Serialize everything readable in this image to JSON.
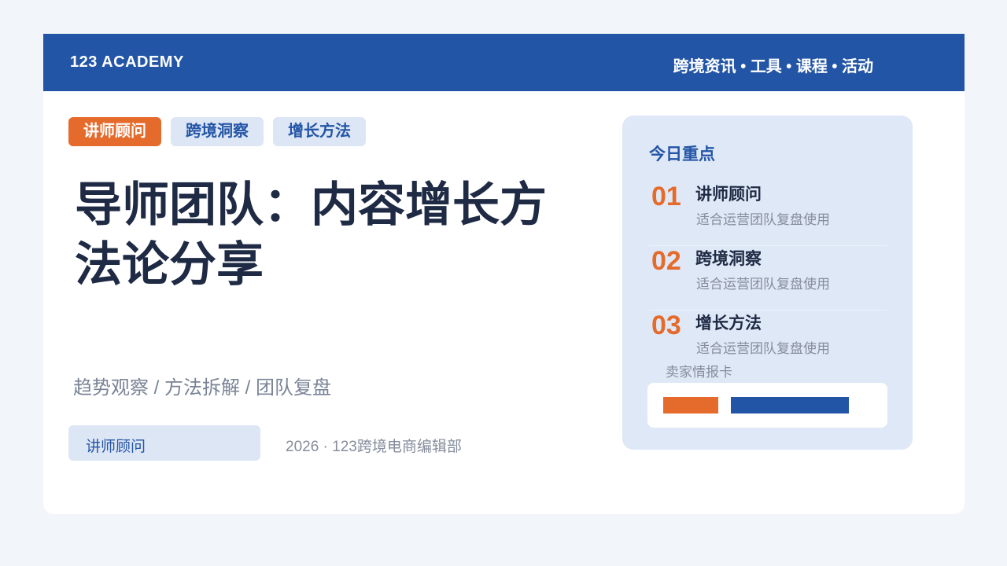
{
  "header": {
    "brand": "123 ACADEMY",
    "nav": "跨境资讯 • 工具 • 课程 • 活动"
  },
  "tags": [
    "讲师顾问",
    "跨境洞察",
    "增长方法"
  ],
  "title": "导师团队：内容增长方法论分享",
  "subtitle": "趋势观察 / 方法拆解 / 团队复盘",
  "author_label": "讲师顾问",
  "footer_meta": "2026 · 123跨境电商编辑部",
  "panel": {
    "title": "今日重点",
    "items": [
      {
        "num": "01",
        "title": "讲师顾问",
        "desc": "适合运营团队复盘使用"
      },
      {
        "num": "02",
        "title": "跨境洞察",
        "desc": "适合运营团队复盘使用"
      },
      {
        "num": "03",
        "title": "增长方法",
        "desc": "适合运营团队复盘使用"
      }
    ],
    "card_label": "卖家情报卡"
  },
  "colors": {
    "brand_blue": "#2355a6",
    "accent_orange": "#e56b2c",
    "text_dark": "#1f2a44",
    "text_muted": "#858d9c",
    "panel_bg": "#dfe8f6",
    "page_bg": "#f2f5fa"
  }
}
